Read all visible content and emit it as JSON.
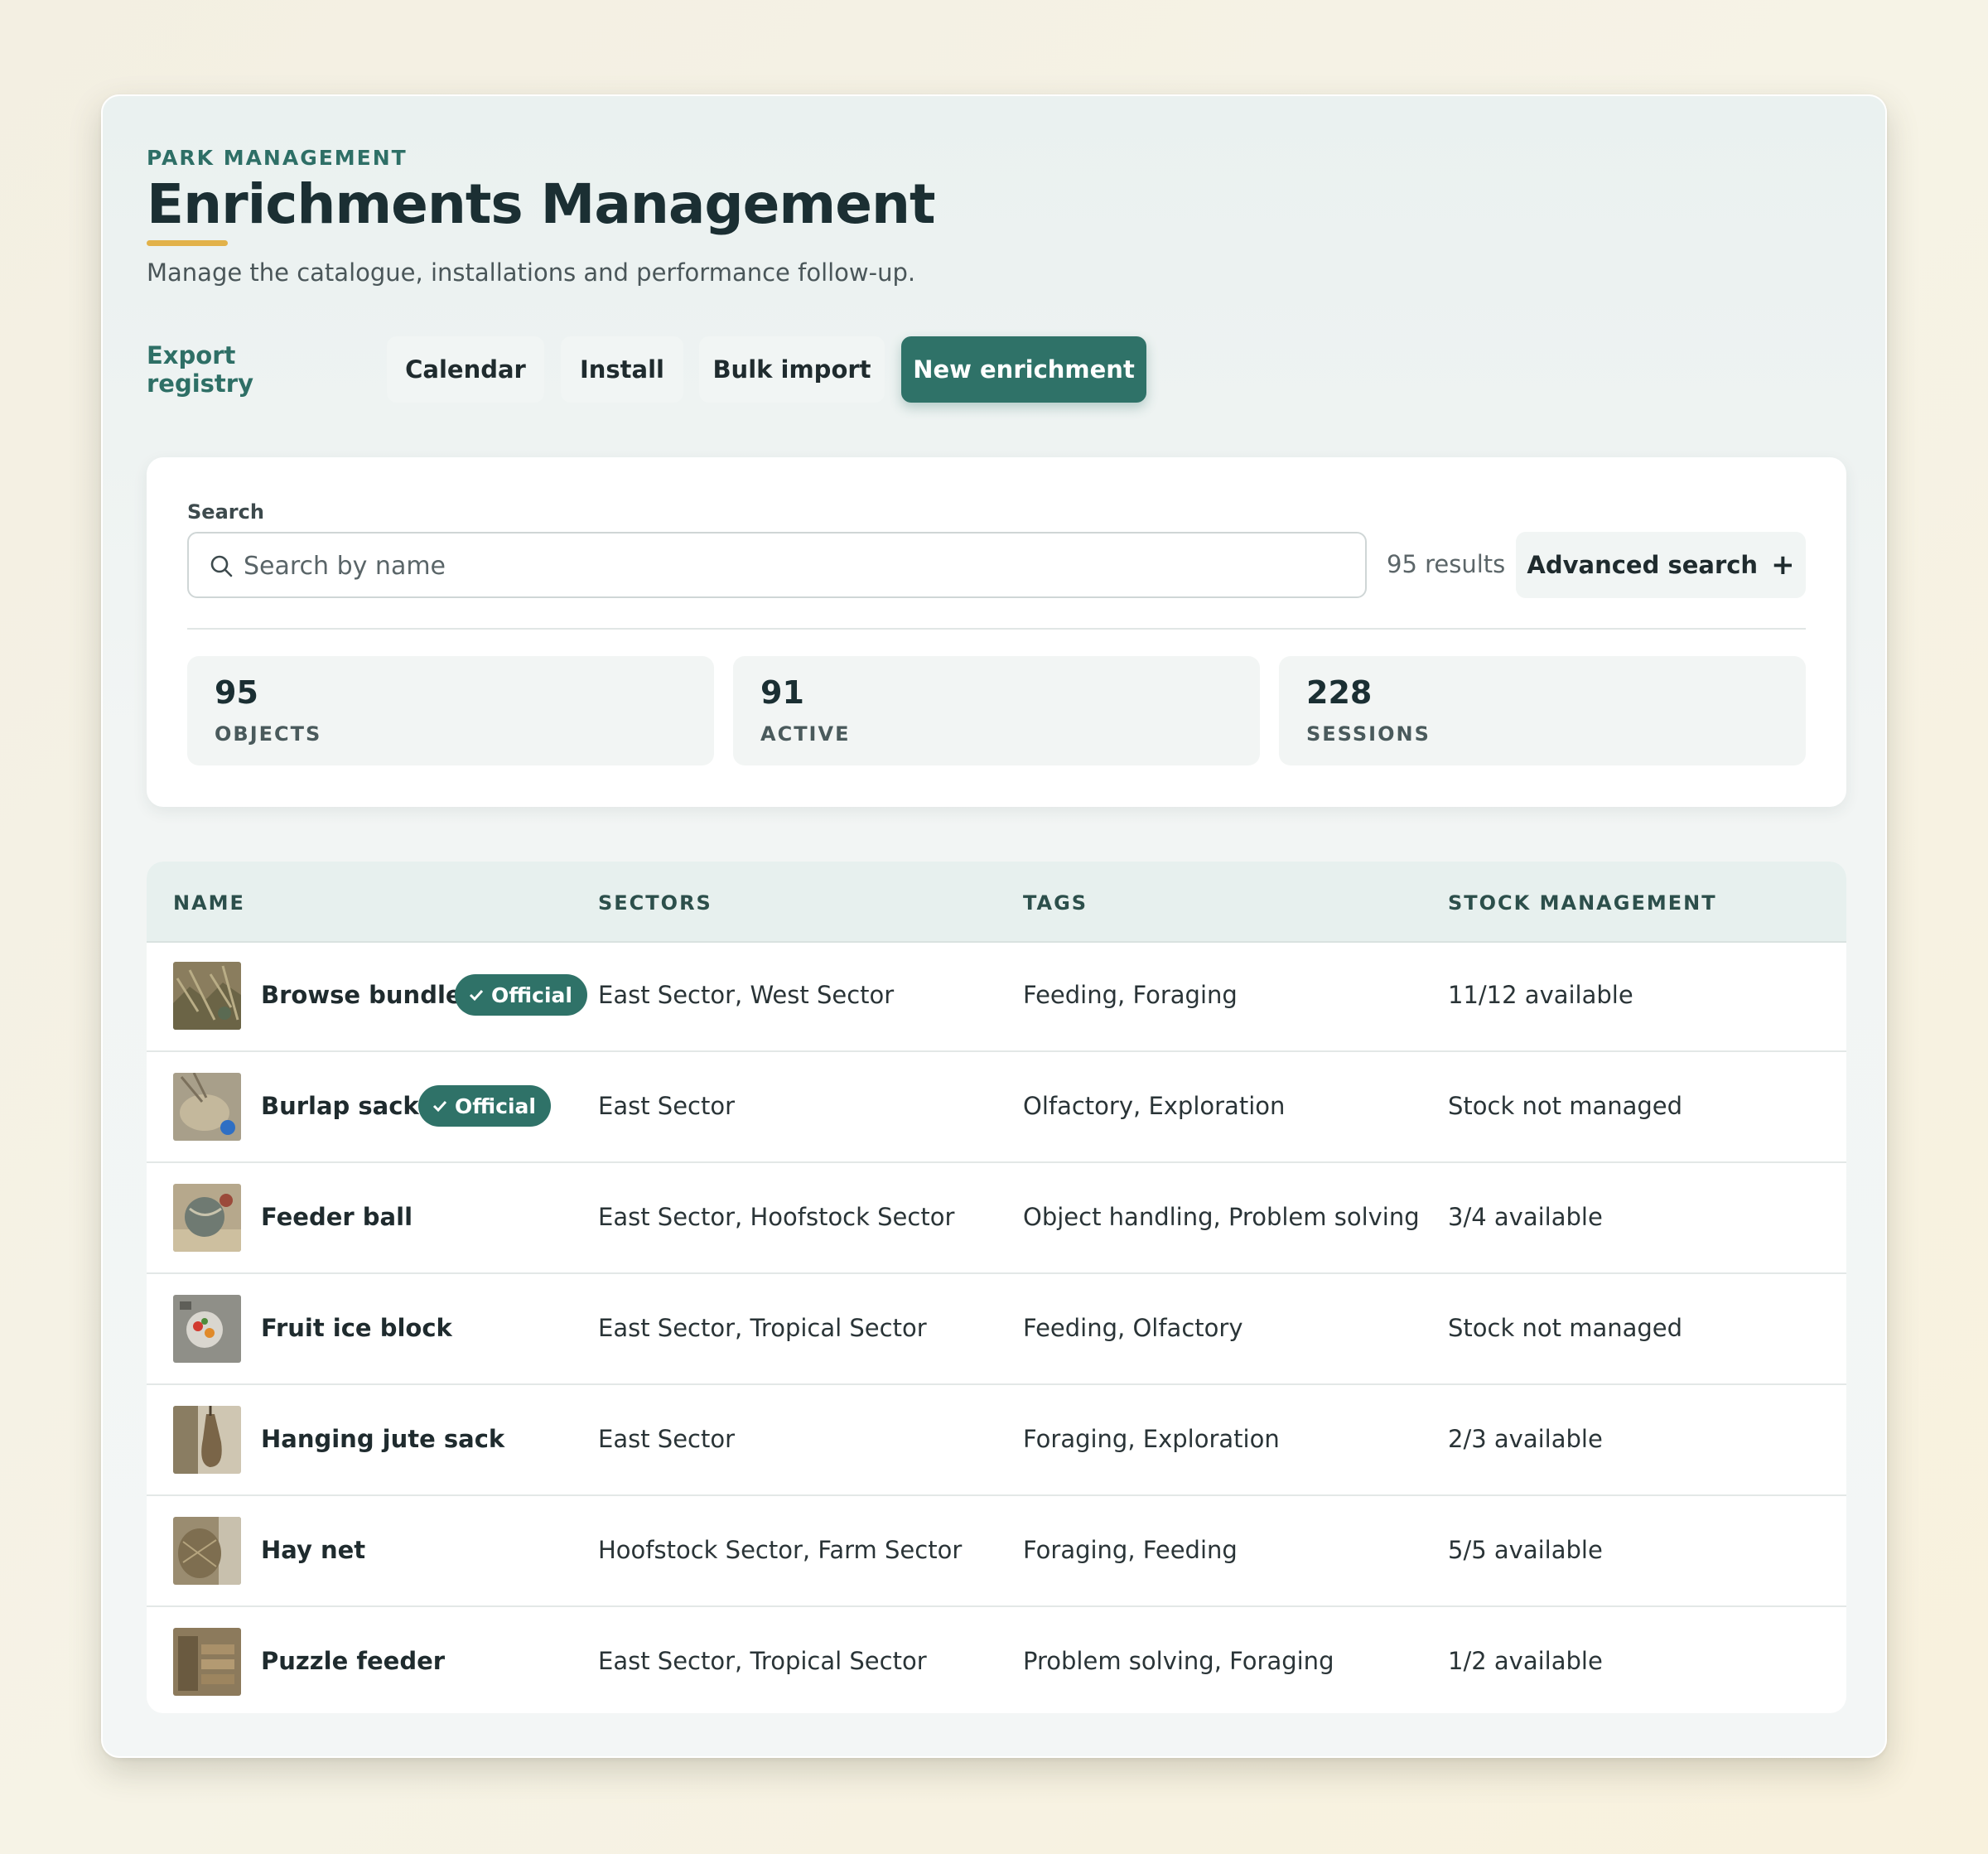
{
  "header": {
    "eyebrow": "PARK MANAGEMENT",
    "title": "Enrichments Management",
    "subtitle": "Manage the catalogue, installations and performance follow-up."
  },
  "actions": {
    "export": "Export registry",
    "calendar": "Calendar",
    "install": "Install",
    "bulk_import": "Bulk import",
    "new_enrichment": "New enrichment"
  },
  "search": {
    "label": "Search",
    "placeholder": "Search by name",
    "value": "",
    "results": "95 results",
    "advanced": "Advanced search",
    "advanced_icon": "+"
  },
  "stats": [
    {
      "value": "95",
      "label": "OBJECTS"
    },
    {
      "value": "91",
      "label": "ACTIVE"
    },
    {
      "value": "228",
      "label": "SESSIONS"
    }
  ],
  "table": {
    "columns": [
      "NAME",
      "SECTORS",
      "TAGS",
      "STOCK MANAGEMENT"
    ],
    "official_label": "Official",
    "rows": [
      {
        "name": "Browse bundle",
        "official": true,
        "sectors": "East Sector, West Sector",
        "tags": "Feeding, Foraging",
        "stock": "11/12 available"
      },
      {
        "name": "Burlap sack",
        "official": true,
        "sectors": "East Sector",
        "tags": "Olfactory, Exploration",
        "stock": "Stock not managed"
      },
      {
        "name": "Feeder ball",
        "official": false,
        "sectors": "East Sector, Hoofstock Sector",
        "tags": "Object handling, Problem solving",
        "stock": "3/4 available"
      },
      {
        "name": "Fruit ice block",
        "official": false,
        "sectors": "East Sector, Tropical Sector",
        "tags": "Feeding, Olfactory",
        "stock": "Stock not managed"
      },
      {
        "name": "Hanging jute sack",
        "official": false,
        "sectors": "East Sector",
        "tags": "Foraging, Exploration",
        "stock": "2/3 available"
      },
      {
        "name": "Hay net",
        "official": false,
        "sectors": "Hoofstock Sector, Farm Sector",
        "tags": "Foraging, Feeding",
        "stock": "5/5 available"
      },
      {
        "name": "Puzzle feeder",
        "official": false,
        "sectors": "East Sector, Tropical Sector",
        "tags": "Problem solving, Foraging",
        "stock": "1/2 available"
      }
    ]
  },
  "colors": {
    "accent": "#2f7268",
    "underline": "#e2b24a",
    "header_bg": "#e7f0ee"
  }
}
